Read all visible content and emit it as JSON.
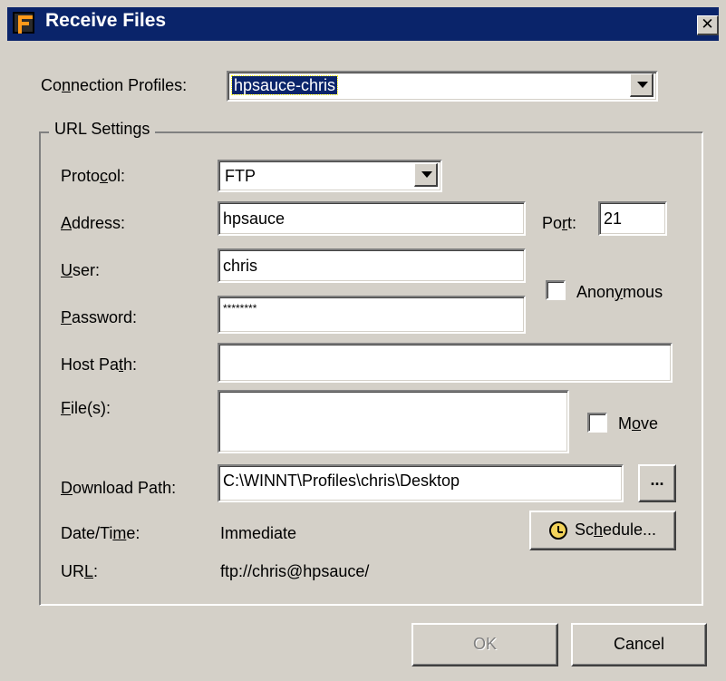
{
  "window": {
    "title": "Receive Files",
    "close_glyph": "✕",
    "title_bar_color": "#0a246a"
  },
  "connection": {
    "label_pre": "Co",
    "label_u": "n",
    "label_post": "nection Profiles:",
    "selected": "hpsauce-chris"
  },
  "url_settings": {
    "group_title": "URL Settings",
    "protocol": {
      "pre": "Proto",
      "u": "c",
      "post": "ol:",
      "value": "FTP"
    },
    "address": {
      "pre": "",
      "u": "A",
      "post": "ddress:",
      "value": "hpsauce"
    },
    "port": {
      "pre": "Po",
      "u": "r",
      "post": "t:",
      "value": "21"
    },
    "user": {
      "pre": "",
      "u": "U",
      "post": "ser:",
      "value": "chris"
    },
    "anonymous": {
      "pre": "Anon",
      "u": "y",
      "post": "mous",
      "checked": false
    },
    "password": {
      "pre": "",
      "u": "P",
      "post": "assword:",
      "value": "********"
    },
    "host_path": {
      "pre": "Host Pa",
      "u": "t",
      "post": "h:",
      "value": ""
    },
    "files": {
      "pre": "",
      "u": "F",
      "post": "ile(s):",
      "value": ""
    },
    "move": {
      "pre": "M",
      "u": "o",
      "post": "ve",
      "checked": false
    },
    "download_path": {
      "pre": "",
      "u": "D",
      "post": "ownload Path:",
      "value": "C:\\WINNT\\Profiles\\chris\\Desktop",
      "browse_label": "..."
    },
    "datetime": {
      "pre": "Date/Ti",
      "u": "m",
      "post": "e:",
      "value": "Immediate"
    },
    "schedule": {
      "pre": "Sc",
      "u": "h",
      "post": "edule...",
      "icon": "clock-icon"
    },
    "url": {
      "pre": "UR",
      "u": "L",
      "post": ":",
      "value": "ftp://chris@hpsauce/"
    }
  },
  "buttons": {
    "ok": "OK",
    "cancel": "Cancel"
  }
}
